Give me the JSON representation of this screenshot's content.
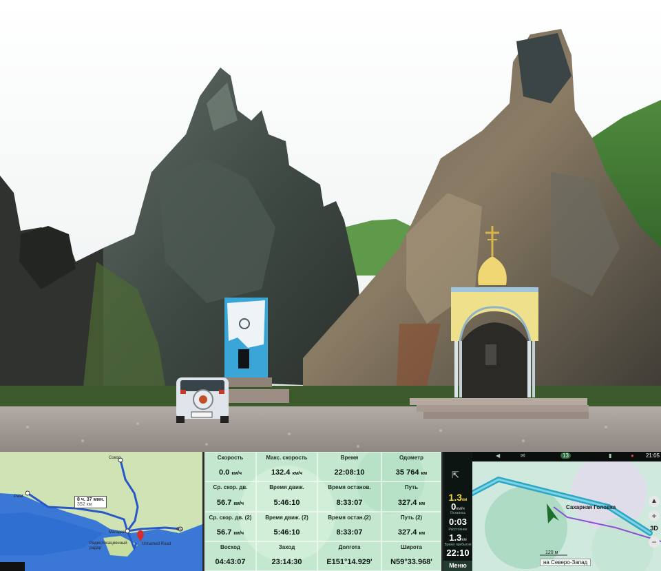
{
  "left_map": {
    "route_box": "8 ч. 37 мин.",
    "route_box_sub": "352 км",
    "places": [
      {
        "name": "Сокол"
      },
      {
        "name": "Palat"
      },
      {
        "name": "Магадан"
      },
      {
        "name": "Ola"
      },
      {
        "name": "Радиолокационный радар"
      },
      {
        "name": "Unnamed Road"
      }
    ]
  },
  "stats": {
    "cells": [
      {
        "label": "Скорость",
        "value": "0.0",
        "unit": "км/ч"
      },
      {
        "label": "Макс. скорость",
        "value": "132.4",
        "unit": "км/ч"
      },
      {
        "label": "Время",
        "value": "22:08:10",
        "unit": ""
      },
      {
        "label": "Одометр",
        "value": "35 764",
        "unit": "км"
      },
      {
        "label": "Ср. скор. дв.",
        "value": "56.7",
        "unit": "км/ч"
      },
      {
        "label": "Время движ.",
        "value": "5:46:10",
        "unit": ""
      },
      {
        "label": "Время останов.",
        "value": "8:33:07",
        "unit": ""
      },
      {
        "label": "Путь",
        "value": "327.4",
        "unit": "км"
      },
      {
        "label": "Ср. скор. дв. (2)",
        "value": "56.7",
        "unit": "км/ч"
      },
      {
        "label": "Время движ. (2)",
        "value": "5:46:10",
        "unit": ""
      },
      {
        "label": "Время остан.(2)",
        "value": "8:33:07",
        "unit": ""
      },
      {
        "label": "Путь (2)",
        "value": "327.4",
        "unit": "км"
      },
      {
        "label": "Восход",
        "value": "04:43:07",
        "unit": ""
      },
      {
        "label": "Заход",
        "value": "23:14:30",
        "unit": ""
      },
      {
        "label": "Долгота",
        "value": "E151°14.929'",
        "unit": ""
      },
      {
        "label": "Широта",
        "value": "N59°33.968'",
        "unit": ""
      }
    ]
  },
  "nav": {
    "clock": "21:05",
    "badge": "13",
    "speed_value": "1.3",
    "speed_unit": "км",
    "current_speed": "0",
    "current_speed_unit": "км/ч",
    "remaining_label": "Осталось",
    "remaining_time": "0:03",
    "distance_label": "Расстояние",
    "distance_value": "1.3",
    "distance_unit": "км",
    "arrival_label": "Время прибытия",
    "arrival_time": "22:10",
    "menu_label": "Меню",
    "place_label": "Сахарная Головка",
    "scale_label": "120 м",
    "direction_label": "на Северо-Запад",
    "view_mode": "3D",
    "accent": "#2ea7c4"
  }
}
